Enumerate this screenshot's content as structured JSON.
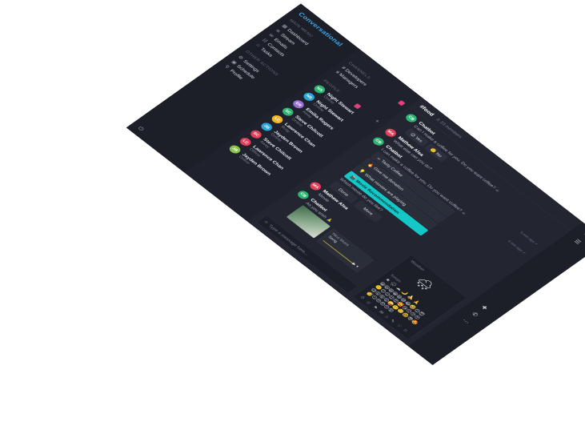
{
  "app": {
    "brand": "Conversational"
  },
  "nav": {
    "section1_title": "Main menu",
    "items1": [
      {
        "icon": "dashboard-icon",
        "glyph": "▦",
        "label": "Dashboard"
      },
      {
        "icon": "stream-icon",
        "glyph": "≋",
        "label": "Stream"
      },
      {
        "icon": "emails-icon",
        "glyph": "✉",
        "label": "Emails"
      },
      {
        "icon": "contacts-icon",
        "glyph": "☷",
        "label": "Contacts"
      },
      {
        "icon": "tasks-icon",
        "glyph": "☆",
        "label": "Tasks"
      }
    ],
    "section2_title": "Other actions",
    "items2": [
      {
        "icon": "settings-icon",
        "glyph": "⚙",
        "label": "Settings"
      },
      {
        "icon": "schedule-icon",
        "glyph": "▣",
        "label": "Schedule"
      },
      {
        "icon": "profile-icon",
        "glyph": "⚲",
        "label": "Profile"
      }
    ],
    "bottom_glyph": "⏻"
  },
  "channels": {
    "channels_title": "Channels",
    "channels_badge": "",
    "channel_list": [
      "# Developers",
      "# Managers"
    ],
    "people_title": "People",
    "people_badge": "",
    "people": [
      {
        "name": "Night Stewart",
        "status": "Online",
        "initials": "NS",
        "color": "#2bb673"
      },
      {
        "name": "Night Stewart",
        "status": "Online",
        "initials": "NS",
        "color": "#2aa7d8"
      },
      {
        "name": "Emilia Rogers",
        "status": "Away",
        "initials": "ER",
        "color": "#9b6fd6"
      },
      {
        "name": "Steve Chilcott",
        "status": "Online",
        "initials": "SC",
        "color": "#2bb673"
      },
      {
        "name": "Lawrence Chan",
        "status": "Busy",
        "initials": "LC",
        "color": "#f0b429"
      },
      {
        "name": "Jayden Brown",
        "status": "Online",
        "initials": "JB",
        "color": "#2aa7d8"
      },
      {
        "name": "Steve Chilcott",
        "status": "Away",
        "initials": "SC",
        "color": "#e0405a"
      },
      {
        "name": "Lawrence Chan",
        "status": "Offline",
        "initials": "LC",
        "color": "#e0405a"
      },
      {
        "name": "Jayden Brown",
        "status": "Online",
        "initials": "JB",
        "color": "#8bc34a"
      }
    ]
  },
  "chat": {
    "title": "#food",
    "members": "23 members",
    "messages": [
      {
        "name": "Chatbot",
        "initials": "CB",
        "color": "#2bb673",
        "time": "",
        "text": "Can I make a coffee for you. Do you want coffee? ☕",
        "options": [
          "😊 Yes",
          "🙁 No"
        ]
      },
      {
        "name": "Mathew Alsa",
        "initials": "MA",
        "color": "#e0405a",
        "time": "5 min ago ✓",
        "text": "What else can you do?",
        "options": []
      },
      {
        "name": "Chatbot",
        "initials": "CB",
        "color": "#2bb673",
        "time": "5 min ago ✓",
        "text": "I can make a coffee for you. Do you want coffee? ☕",
        "list": [
          "☕ Tasty Coffee",
          "🔥 Give me donation",
          "💡 What movies are playing",
          "🎬 Movie Recommendation"
        ],
        "selected": 3,
        "question": "Which movie do you like?",
        "buttons": [
          "Done",
          "More"
        ]
      },
      {
        "name": "Mathew Alsa",
        "initials": "MA",
        "color": "#e0405a",
        "time": "",
        "text": "Movie",
        "options": []
      },
      {
        "name": "Chatbot",
        "initials": "CB",
        "color": "#2bb673",
        "time": "5 min ago ✓",
        "text": "As you wish 🙏",
        "media": true,
        "audio_title": "Nice blues",
        "audio_artist": "Song"
      }
    ],
    "composer_placeholder": "Type a message here..."
  },
  "picker": {
    "title": "Weather",
    "weather_glyph": "🌨",
    "emoji_label": "Emojis",
    "emoji_row": "★ 🌧 ☁ 🌙 🍌 🙏",
    "emoji_grid": "😀😃😄😁😆😅😂🤣😊😇🙂🙃😉😌😍🥰😘😗😙😚😋😛😝😜🤪🤨🧐🤓😎🤩🥳😏😒😞😔😟",
    "toolbar": [
      "⏱",
      "☺",
      "⚑",
      "✉",
      "⌂",
      "✎",
      "♡",
      "⚐"
    ]
  },
  "rail": {
    "icons": [
      "✚",
      "✆",
      "⋯"
    ],
    "top": "⍟",
    "menu": "☰"
  }
}
